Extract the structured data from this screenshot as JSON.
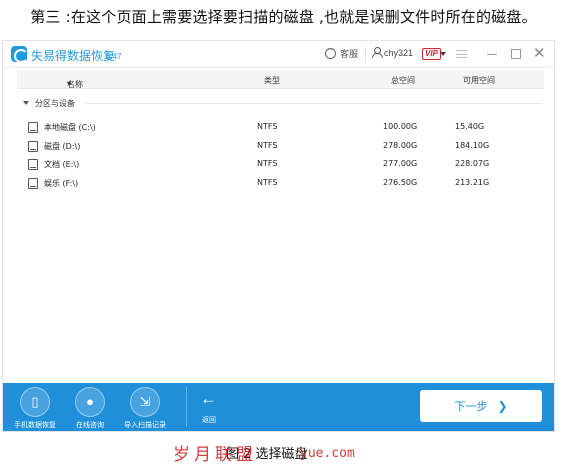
{
  "caption_top": "第三 :在这个页面上需要选择要扫描的磁盘 ,也就是误删文件时所在的磁盘。",
  "app": {
    "title": "失易得数据恢复",
    "version": "6.47",
    "kefu_label": "客服",
    "username": "chy321",
    "vip_label": "VIP"
  },
  "columns": {
    "name": "名称",
    "type": "类型",
    "total": "总空间",
    "free": "可用空间"
  },
  "group_label": "分区与设备",
  "disks": [
    {
      "name": "本地磁盘 (C:\\)",
      "type": "NTFS",
      "total": "100.00G",
      "free": "15.40G"
    },
    {
      "name": "磁盘 (D:\\)",
      "type": "NTFS",
      "total": "278.00G",
      "free": "184.10G"
    },
    {
      "name": "文档 (E:\\)",
      "type": "NTFS",
      "total": "277.00G",
      "free": "228.07G"
    },
    {
      "name": "娱乐 (F:\\)",
      "type": "NTFS",
      "total": "276.50G",
      "free": "213.21G"
    }
  ],
  "bottom": {
    "buttons": [
      {
        "label": "手机数据恢复",
        "icon": "phone-icon"
      },
      {
        "label": "在线咨询",
        "icon": "user-consult-icon"
      },
      {
        "label": "导入扫描记录",
        "icon": "import-icon"
      }
    ],
    "back_label": "返回",
    "next_label": "下一步"
  },
  "caption_bottom": "图 2  选择磁盘",
  "watermark": "岁月联盟",
  "watermark_url": "yue.com",
  "colors": {
    "accent": "#1e8fd8",
    "brand": "#1e9be0",
    "vip": "#d9252a",
    "watermark": "#d01818"
  }
}
